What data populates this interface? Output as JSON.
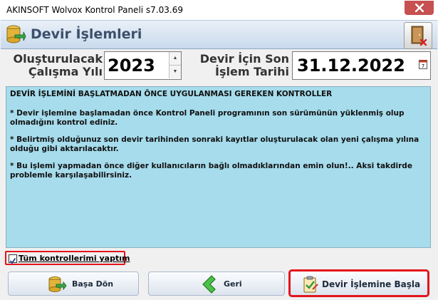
{
  "window": {
    "title": "AKINSOFT Wolvox Kontrol Paneli s7.03.69"
  },
  "header": {
    "title": "Devir İşlemleri"
  },
  "fields": {
    "year_label_line1": "Oluşturulacak",
    "year_label_line2": "Çalışma Yılı",
    "year_value": "2023",
    "date_label_line1": "Devir İçin Son",
    "date_label_line2": "İşlem Tarihi",
    "date_value": "31.12.2022"
  },
  "notice": {
    "heading": "DEVİR İŞLEMİNİ BAŞLATMADAN ÖNCE UYGULANMASI GEREKEN KONTROLLER",
    "items": [
      "* Devir işlemine başlamadan önce Kontrol Paneli programının son sürümünün yüklenmiş olup olmadığını kontrol ediniz.",
      "* Belirtmiş olduğunuz son devir tarihinden sonraki kayıtlar oluşturulacak olan yeni çalışma yılına olduğu gibi aktarılacaktır.",
      "* Bu işlemi yapmadan önce diğer kullanıcıların bağlı olmadıklarından emin olun!.. Aksi takdirde problemle karşılaşabilirsiniz."
    ]
  },
  "checkbox": {
    "label": "Tüm kontrollerimi yaptım",
    "checked": true
  },
  "buttons": {
    "home": "Başa Dön",
    "back": "Geri",
    "start": "Devir İşlemine Başla"
  },
  "colors": {
    "notice_bg": "#a6dcec",
    "highlight": "#e3141b",
    "header_text": "#3d4f6a"
  }
}
